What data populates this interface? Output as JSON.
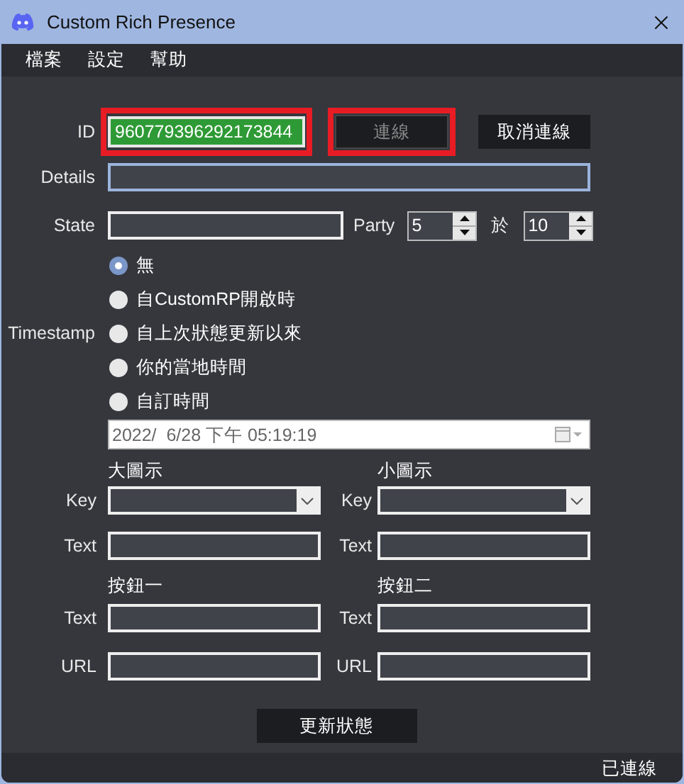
{
  "window": {
    "title": "Custom Rich Presence"
  },
  "menu": [
    "檔案",
    "設定",
    "幫助"
  ],
  "id": {
    "label": "ID",
    "value": "960779396292173844",
    "highlighted": true
  },
  "connect_button": {
    "label": "連線",
    "disabled": true,
    "highlighted": true
  },
  "disconnect_button": {
    "label": "取消連線",
    "disabled": false
  },
  "details": {
    "label": "Details",
    "focused": true
  },
  "state": {
    "label": "State",
    "focused": false
  },
  "party": {
    "label": "Party",
    "value": "5",
    "separator": "於",
    "max": "10"
  },
  "timestamp": {
    "label": "Timestamp",
    "options": [
      {
        "label": "無",
        "selected": true
      },
      {
        "label": "自CustomRP開啟時",
        "selected": false
      },
      {
        "label": "自上次狀態更新以來",
        "selected": false
      },
      {
        "label": "你的當地時間",
        "selected": false
      },
      {
        "label": "自訂時間",
        "selected": false
      }
    ]
  },
  "datetime": "2022/  6/28 下午 05:19:19",
  "images": [
    {
      "heading": "大圖示",
      "key_label": "Key",
      "text_label": "Text"
    },
    {
      "heading": "小圖示",
      "key_label": "Key",
      "text_label": "Text"
    }
  ],
  "buttons": [
    {
      "heading": "按鈕一",
      "text_label": "Text",
      "url_label": "URL"
    },
    {
      "heading": "按鈕二",
      "text_label": "Text",
      "url_label": "URL"
    }
  ],
  "update_button": "更新狀態",
  "status_bar": "已連線"
}
